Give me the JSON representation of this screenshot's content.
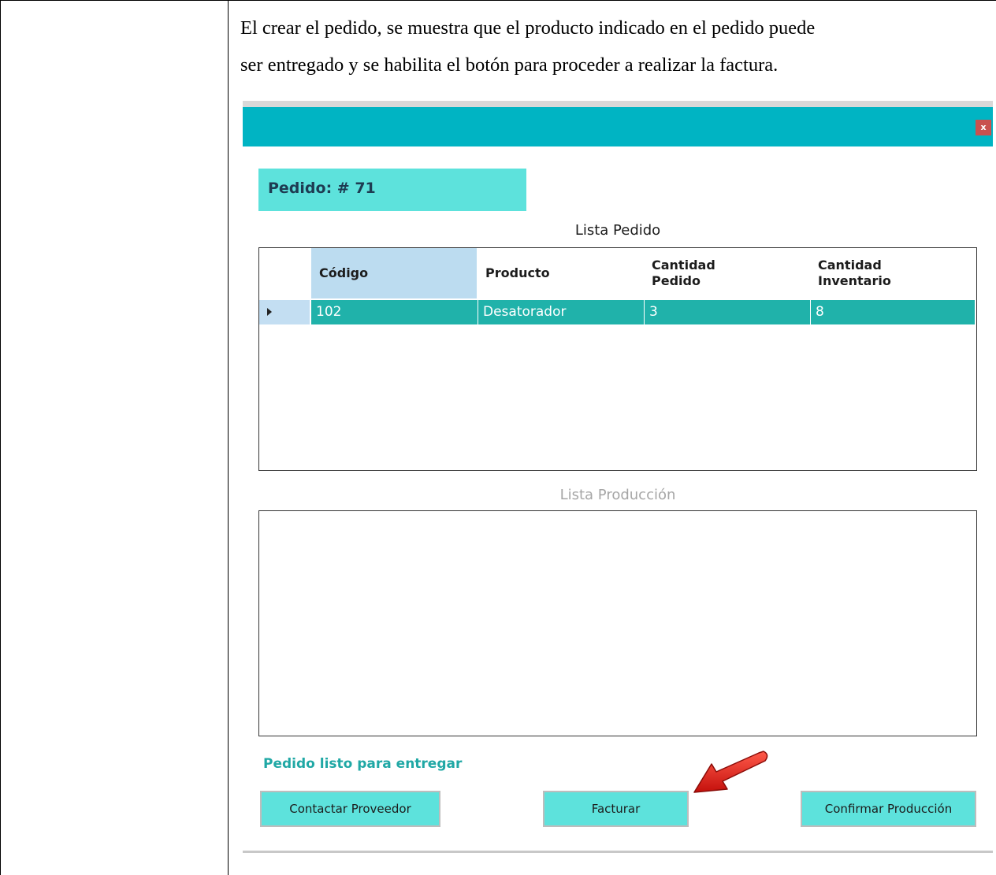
{
  "caption": {
    "line1": "El crear el pedido, se muestra que el producto indicado en el pedido puede",
    "line2": "ser entregado y se habilita el botón para proceder a realizar la factura."
  },
  "window": {
    "close_label": "x",
    "order_label": "Pedido: # 71",
    "lista_pedido_title": "Lista Pedido",
    "lista_produccion_title": "Lista Producción",
    "columns": [
      {
        "line1": "Código",
        "line2": ""
      },
      {
        "line1": "Producto",
        "line2": ""
      },
      {
        "line1": "Cantidad",
        "line2": "Pedido"
      },
      {
        "line1": "Cantidad",
        "line2": "Inventario"
      }
    ],
    "rows": [
      {
        "codigo": "102",
        "producto": "Desatorador",
        "cantidad_pedido": "3",
        "cantidad_inventario": "8"
      }
    ],
    "status_message": "Pedido listo para entregar",
    "buttons": {
      "contactar": "Contactar Proveedor",
      "facturar": "Facturar",
      "confirmar": "Confirmar Producción"
    }
  },
  "colors": {
    "titlebar": "#00b4c3",
    "accent": "#5de2dc",
    "selected_row": "#20b2aa",
    "status_text": "#20a8a5",
    "close_button": "#c9514f",
    "arrow": "#e0201a"
  },
  "icons": [
    "close-icon",
    "row-selector-arrow-icon",
    "red-pointer-arrow-icon"
  ]
}
